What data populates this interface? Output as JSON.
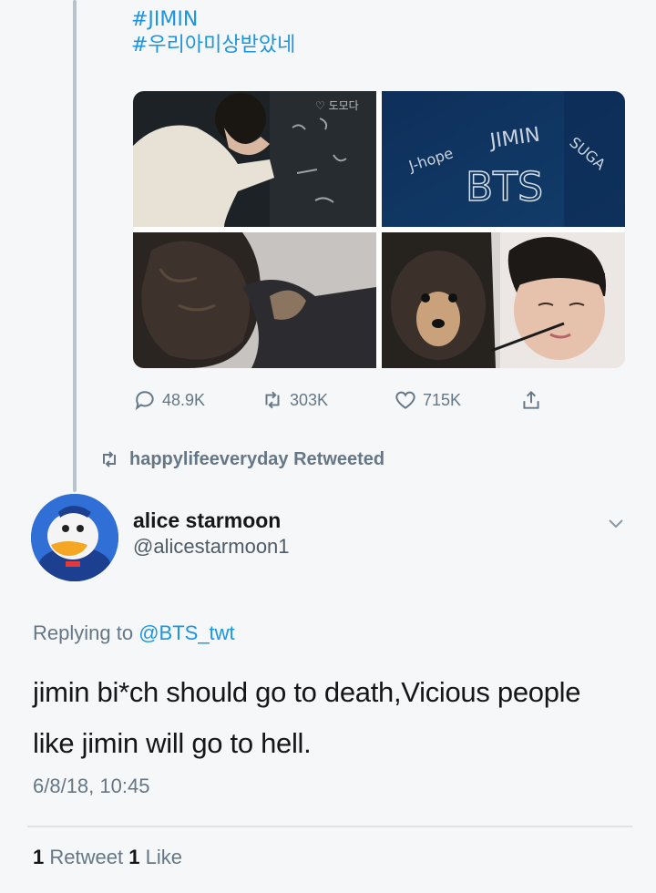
{
  "quoted_tweet": {
    "hashtags": [
      "#JIMIN",
      "#우리아미상받았네"
    ],
    "actions": {
      "replies": "48.9K",
      "retweets": "303K",
      "likes": "715K"
    }
  },
  "retweet_context": {
    "text": "happylifeeveryday Retweeted"
  },
  "tweet": {
    "author_name": "alice starmoon",
    "author_handle": "@alicestarmoon1",
    "replying_prefix": "Replying to",
    "replying_to": "@BTS_twt",
    "text": "jimin bi*ch should go to death,Vicious people like jimin will go to hell.",
    "timestamp": "6/8/18, 10:45",
    "retweet_count": "1",
    "retweet_label": "Retweet",
    "like_count": "1",
    "like_label": "Like"
  },
  "photo_text": {
    "chalk_names": [
      "J-hope",
      "JIMIN",
      "SUGA",
      "BTS"
    ]
  },
  "colors": {
    "link": "#1b95e0",
    "muted": "#657786",
    "text": "#14171a"
  }
}
